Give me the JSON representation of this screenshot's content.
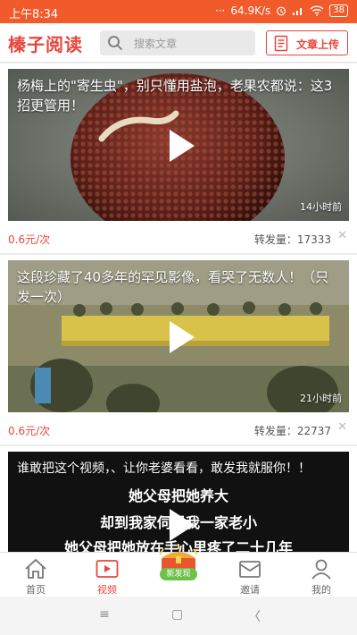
{
  "status_bar": {
    "time": "上午8:34",
    "signal_dots": "···",
    "network_speed": "64.9K/s",
    "battery": "38"
  },
  "header": {
    "logo": "榛子阅读",
    "search_placeholder": "搜索文章",
    "upload_label": "文章上传"
  },
  "feed": [
    {
      "title": "杨梅上的\"寄生虫\"，别只懂用盐泡，老果农都说：这3招更管用！",
      "age": "14小时前",
      "price": "0.6元/次",
      "shares": "转发量：17333",
      "close": "✕"
    },
    {
      "title": "这段珍藏了40多年的罕见影像，看哭了无数人！（只发一次）",
      "age": "21小时前",
      "price": "0.6元/次",
      "shares": "转发量：22737",
      "close": "✕"
    },
    {
      "title": "谁敢把这个视频，、让你老婆看看，敢发我就服你！！",
      "subtitle_lines": [
        "她父母把她养大",
        "却到我家伺候我一家老小",
        "她父母把她放在手心里疼了二十几年"
      ]
    }
  ],
  "tabbar": [
    {
      "label": "首页"
    },
    {
      "label": "视频"
    },
    {
      "label": "新发现"
    },
    {
      "label": "邀请"
    },
    {
      "label": "我的"
    }
  ],
  "navbar": {
    "menu": "≡",
    "home": "▢",
    "back": "〈"
  },
  "colors": {
    "brand": "#e8453c",
    "status_bar": "#f15a2b",
    "discover_badge": "#6cc24a"
  }
}
